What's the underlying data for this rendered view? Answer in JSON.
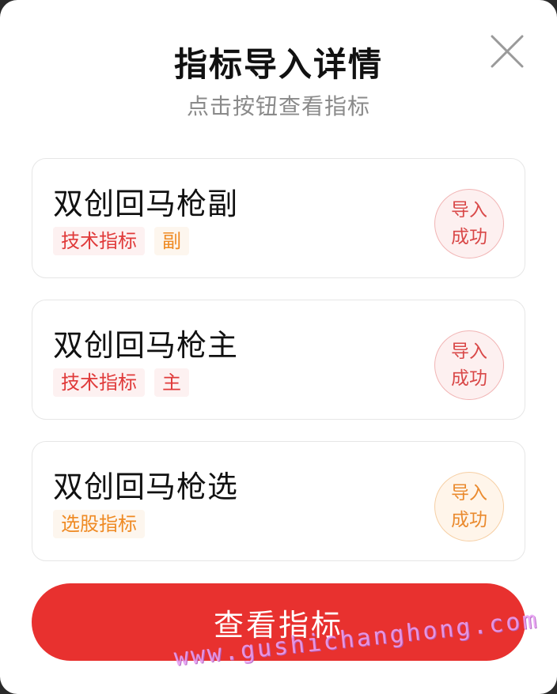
{
  "dialog": {
    "title": "指标导入详情",
    "subtitle": "点击按钮查看指标",
    "close_icon": "close-icon"
  },
  "items": [
    {
      "name": "双创回马枪副",
      "tags": [
        {
          "label": "技术指标",
          "color": "#e03a3a"
        },
        {
          "label": "副",
          "color": "#ef8a23"
        }
      ],
      "status_line1": "导入",
      "status_line2": "成功",
      "status_color": "#d94848"
    },
    {
      "name": "双创回马枪主",
      "tags": [
        {
          "label": "技术指标",
          "color": "#e03a3a"
        },
        {
          "label": "主",
          "color": "#e03a3a"
        }
      ],
      "status_line1": "导入",
      "status_line2": "成功",
      "status_color": "#d94848"
    },
    {
      "name": "双创回马枪选",
      "tags": [
        {
          "label": "选股指标",
          "color": "#ef8a23"
        }
      ],
      "status_line1": "导入",
      "status_line2": "成功",
      "status_color": "#ea8a2e"
    }
  ],
  "action": {
    "label": "查看指标",
    "color": "#e8312f"
  },
  "watermark": "www.gushichanghong.com"
}
